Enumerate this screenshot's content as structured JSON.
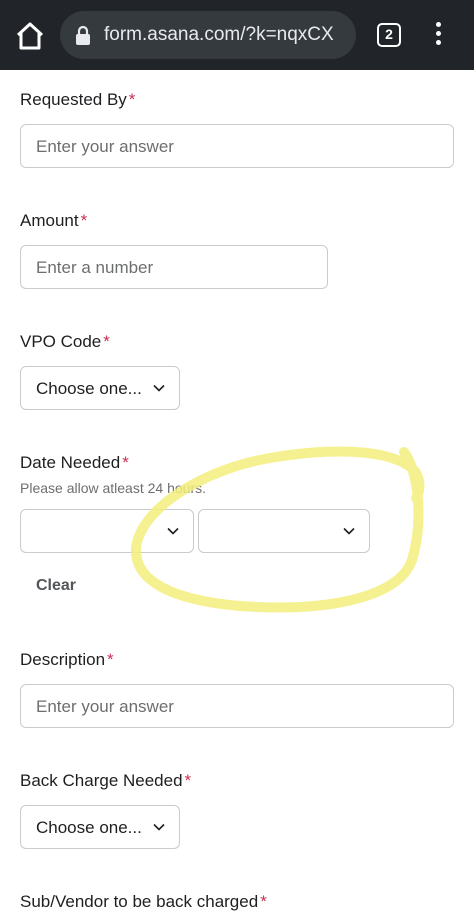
{
  "browser": {
    "url": "form.asana.com/?k=nqxCX",
    "tab_count": "2"
  },
  "form": {
    "requested_by": {
      "label": "Requested By",
      "required": "*",
      "placeholder": "Enter your answer"
    },
    "amount": {
      "label": "Amount",
      "required": "*",
      "placeholder": "Enter a number"
    },
    "vpo_code": {
      "label": "VPO Code",
      "required": "*",
      "selected": "Choose one..."
    },
    "date_needed": {
      "label": "Date Needed",
      "required": "*",
      "hint": "Please allow atleast 24 hours.",
      "clear_label": "Clear"
    },
    "description": {
      "label": "Description",
      "required": "*",
      "placeholder": "Enter your answer"
    },
    "back_charge_needed": {
      "label": "Back Charge Needed",
      "required": "*",
      "selected": "Choose one..."
    },
    "sub_vendor": {
      "label": "Sub/Vendor to be back charged",
      "required": "*"
    }
  },
  "icons": {
    "home": "home-icon",
    "lock": "lock-icon",
    "more": "more-vert-icon",
    "chevron": "chevron-down-icon"
  },
  "colors": {
    "required_asterisk": "#c92f54",
    "annotation_highlight": "#f3ee7c",
    "browser_bar": "#212529"
  }
}
